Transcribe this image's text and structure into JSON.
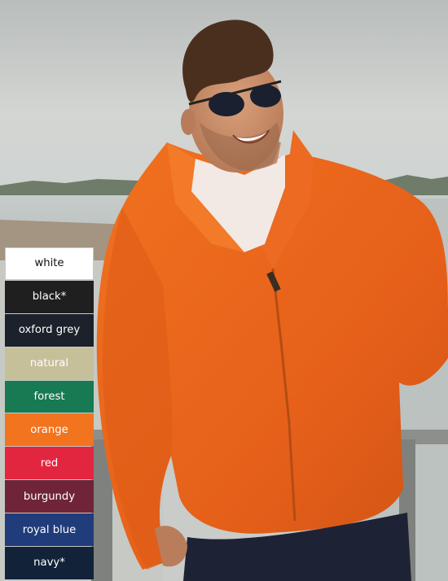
{
  "swatches": [
    {
      "label": "white",
      "color": "#ffffff",
      "text_color": "#111111"
    },
    {
      "label": "black*",
      "color": "#1f1f20",
      "text_color": "#ffffff"
    },
    {
      "label": "oxford grey",
      "color": "#1c222b",
      "text_color": "#ffffff"
    },
    {
      "label": "natural",
      "color": "#c6c09a",
      "text_color": "#ffffff"
    },
    {
      "label": "forest",
      "color": "#177a52",
      "text_color": "#ffffff"
    },
    {
      "label": "orange",
      "color": "#f2741f",
      "text_color": "#ffffff"
    },
    {
      "label": "red",
      "color": "#e3263f",
      "text_color": "#ffffff"
    },
    {
      "label": "burgundy",
      "color": "#702439",
      "text_color": "#ffffff"
    },
    {
      "label": "royal blue",
      "color": "#203c7a",
      "text_color": "#ffffff"
    },
    {
      "label": "navy*",
      "color": "#112239",
      "text_color": "#ffffff"
    }
  ],
  "photo": {
    "subject": "man wearing orange fleece jacket and sunglasses",
    "jacket_color": "#e8641c",
    "background": "lakeside with railing"
  }
}
